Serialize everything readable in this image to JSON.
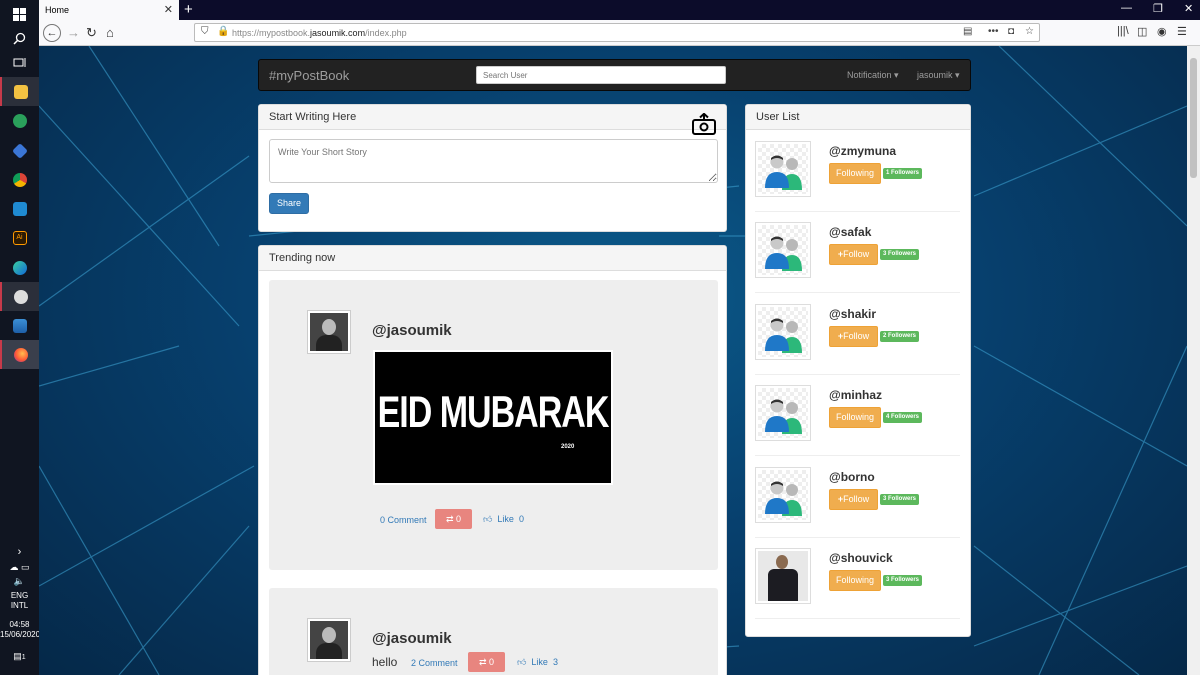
{
  "taskbar": {
    "language": "ENG",
    "layout": "INTL",
    "time": "04:58",
    "date": "15/06/2020",
    "notif_count": "1"
  },
  "browser": {
    "tab_title": "Home",
    "url_prefix": "https://mypostbook.",
    "url_domain": "jasoumik.com",
    "url_path": "/index.php"
  },
  "app": {
    "brand": "#myPostBook",
    "search_placeholder": "Search User",
    "notification_label": "Notification",
    "user_label": "jasoumik"
  },
  "composer": {
    "title": "Start Writing Here",
    "placeholder": "Write Your Short Story",
    "share_label": "Share"
  },
  "trending": {
    "title": "Trending now",
    "posts": [
      {
        "user": "@jasoumik",
        "image_text": "EID MUBARAK",
        "image_year": "2020",
        "comments": "0 Comment",
        "reposts": "0",
        "like_label": "Like",
        "likes": "0"
      },
      {
        "user": "@jasoumik",
        "text": "hello",
        "comments": "2 Comment",
        "reposts": "0",
        "like_label": "Like",
        "likes": "3"
      }
    ]
  },
  "user_list": {
    "title": "User List",
    "users": [
      {
        "name": "@zmymuna",
        "action": "Following",
        "followers": "1 Followers"
      },
      {
        "name": "@safak",
        "action": "Follow",
        "followers": "3 Followers"
      },
      {
        "name": "@shakir",
        "action": "Follow",
        "followers": "2 Followers"
      },
      {
        "name": "@minhaz",
        "action": "Following",
        "followers": "4 Followers"
      },
      {
        "name": "@borno",
        "action": "Follow",
        "followers": "3 Followers"
      },
      {
        "name": "@shouvick",
        "action": "Following",
        "followers": "3 Followers"
      }
    ]
  },
  "colors": {
    "brand_nav": "#222222",
    "primary": "#337ab7",
    "warning": "#f0ad4e",
    "success": "#5cb85c",
    "repost": "#e8857f"
  }
}
